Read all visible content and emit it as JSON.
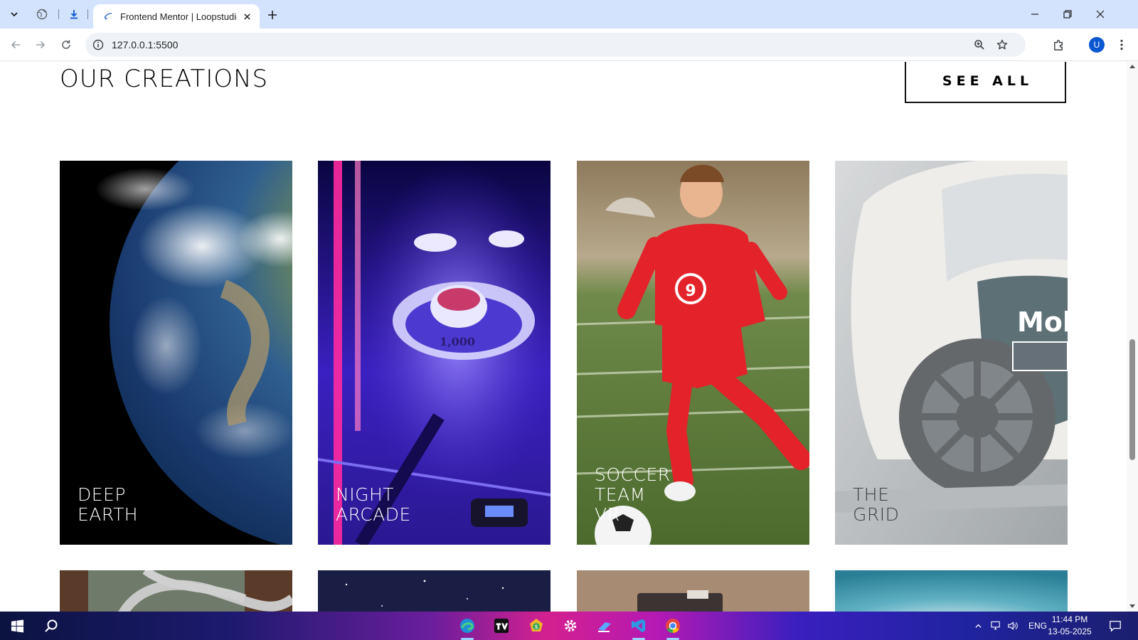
{
  "browser": {
    "tab_title": "Frontend Mentor | Loopstudios",
    "url": "127.0.0.1:5500",
    "profile_initial": "U"
  },
  "page": {
    "title": "OUR CREATIONS",
    "see_all_label": "SEE ALL",
    "cards": [
      {
        "label": "DEEP\nEARTH",
        "image": "earth-from-space"
      },
      {
        "label": "NIGHT\nARCADE",
        "image": "skee-ball-arcade"
      },
      {
        "label": "SOCCER\nTEAM\nVR",
        "image": "soccer-player"
      },
      {
        "label": "THE\nGRID",
        "image": "race-car"
      }
    ],
    "second_row_images": [
      "aerial-curvy-road",
      "starry-sky",
      "desert-rover",
      "aerial-ocean"
    ]
  },
  "taskbar": {
    "language": "ENG",
    "time": "11:44 PM",
    "date": "13-05-2025",
    "apps": [
      "edge",
      "tradingview",
      "money-app",
      "settings",
      "file-manager",
      "vscode",
      "chrome"
    ]
  },
  "colors": {
    "tabstrip": "#d3e3fd",
    "card_label": "#ffffff",
    "accent": "#0b57d0"
  }
}
